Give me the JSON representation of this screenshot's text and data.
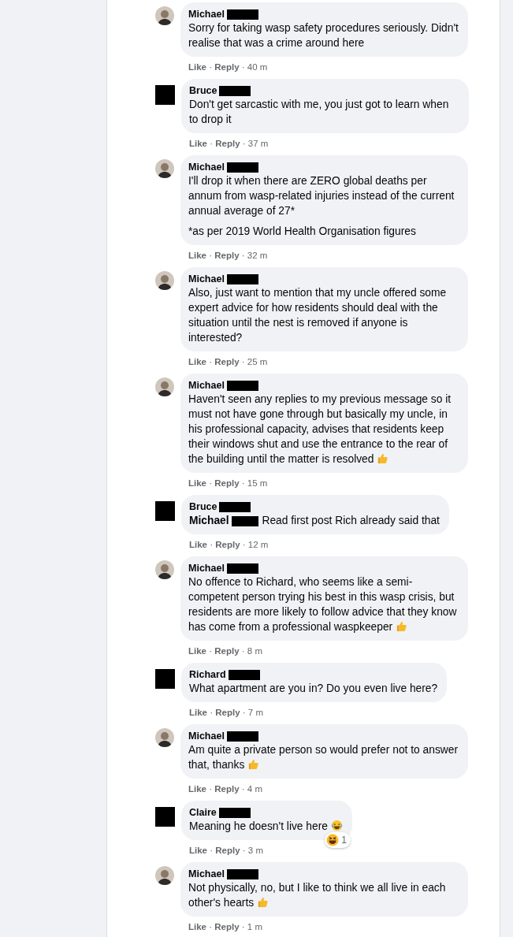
{
  "comments": [
    {
      "author": "Michael",
      "surname_redacted": true,
      "avatar": {
        "kind": "photo"
      },
      "paragraphs": [
        "Sorry for taking wasp safety procedures seriously. Didn't realise that was a crime around here"
      ],
      "like": "Like",
      "dots": [
        "·",
        "·"
      ],
      "reply": "Reply",
      "time": "40 m"
    },
    {
      "author": "Bruce",
      "surname_redacted": true,
      "avatar": {
        "kind": "redacted"
      },
      "paragraphs": [
        "Don't get sarcastic with me, you just got to learn when to drop it"
      ],
      "like": "Like",
      "dots": [
        "·",
        "·"
      ],
      "reply": "Reply",
      "time": "37 m"
    },
    {
      "author": "Michael",
      "surname_redacted": true,
      "avatar": {
        "kind": "photo"
      },
      "paragraphs": [
        "I'll drop it when there are ZERO global deaths per annum from wasp-related injuries instead of the current annual average of 27*",
        "*as per 2019 World Health Organisation figures"
      ],
      "like": "Like",
      "dots": [
        "·",
        "·"
      ],
      "reply": "Reply",
      "time": "32 m"
    },
    {
      "author": "Michael",
      "surname_redacted": true,
      "avatar": {
        "kind": "photo"
      },
      "paragraphs": [
        "Also, just want to mention that my uncle offered some expert advice for how residents should deal with the situation until the nest is removed if anyone is interested?"
      ],
      "like": "Like",
      "dots": [
        "·",
        "·"
      ],
      "reply": "Reply",
      "time": "25 m"
    },
    {
      "author": "Michael",
      "surname_redacted": true,
      "avatar": {
        "kind": "photo"
      },
      "paragraphs": [
        "Haven't seen any replies to my previous message so it must not have gone through but basically my uncle, in his professional capacity, advises that residents keep their windows shut and use the entrance to the rear of the building until the matter is resolved"
      ],
      "emoji": {
        "kind": "thumbs-up"
      },
      "like": "Like",
      "dots": [
        "·",
        "·"
      ],
      "reply": "Reply",
      "time": "15 m"
    },
    {
      "author": "Bruce",
      "surname_redacted": true,
      "avatar": {
        "kind": "redacted"
      },
      "mention": "Michael",
      "mention_redacted": true,
      "paragraphs": [
        "Read first post Rich already said that"
      ],
      "like": "Like",
      "dots": [
        "·",
        "·"
      ],
      "reply": "Reply",
      "time": "12 m"
    },
    {
      "author": "Michael",
      "surname_redacted": true,
      "avatar": {
        "kind": "photo"
      },
      "paragraphs": [
        "No offence to Richard, who seems like a semi-competent person trying his best in this wasp crisis, but residents are more likely to follow advice that they know has come from a professional waspkeeper"
      ],
      "emoji": {
        "kind": "thumbs-up"
      },
      "like": "Like",
      "dots": [
        "·",
        "·"
      ],
      "reply": "Reply",
      "time": "8 m"
    },
    {
      "author": "Richard",
      "surname_redacted": true,
      "avatar": {
        "kind": "redacted"
      },
      "paragraphs": [
        "What apartment are you in? Do you even live here?"
      ],
      "like": "Like",
      "dots": [
        "·",
        "·"
      ],
      "reply": "Reply",
      "time": "7 m"
    },
    {
      "author": "Michael",
      "surname_redacted": true,
      "avatar": {
        "kind": "photo"
      },
      "paragraphs": [
        "Am quite a private person so would prefer not to answer that, thanks"
      ],
      "emoji": {
        "kind": "thumbs-up"
      },
      "like": "Like",
      "dots": [
        "·",
        "·"
      ],
      "reply": "Reply",
      "time": "4 m"
    },
    {
      "author": "Claire",
      "surname_redacted": true,
      "avatar": {
        "kind": "redacted"
      },
      "paragraphs": [
        "Meaning he doesn't live here"
      ],
      "emoji": {
        "kind": "tears-of-joy"
      },
      "reaction": {
        "emoji": {
          "kind": "laughing"
        },
        "count": "1"
      },
      "like": "Like",
      "dots": [
        "·",
        "·"
      ],
      "reply": "Reply",
      "time": "3 m"
    },
    {
      "author": "Michael",
      "surname_redacted": true,
      "avatar": {
        "kind": "photo"
      },
      "paragraphs": [
        "Not physically, no, but I like to think we all live in each other's hearts"
      ],
      "emoji": {
        "kind": "thumbs-up"
      },
      "like": "Like",
      "dots": [
        "·",
        "·"
      ],
      "reply": "Reply",
      "time": "1 m"
    }
  ]
}
